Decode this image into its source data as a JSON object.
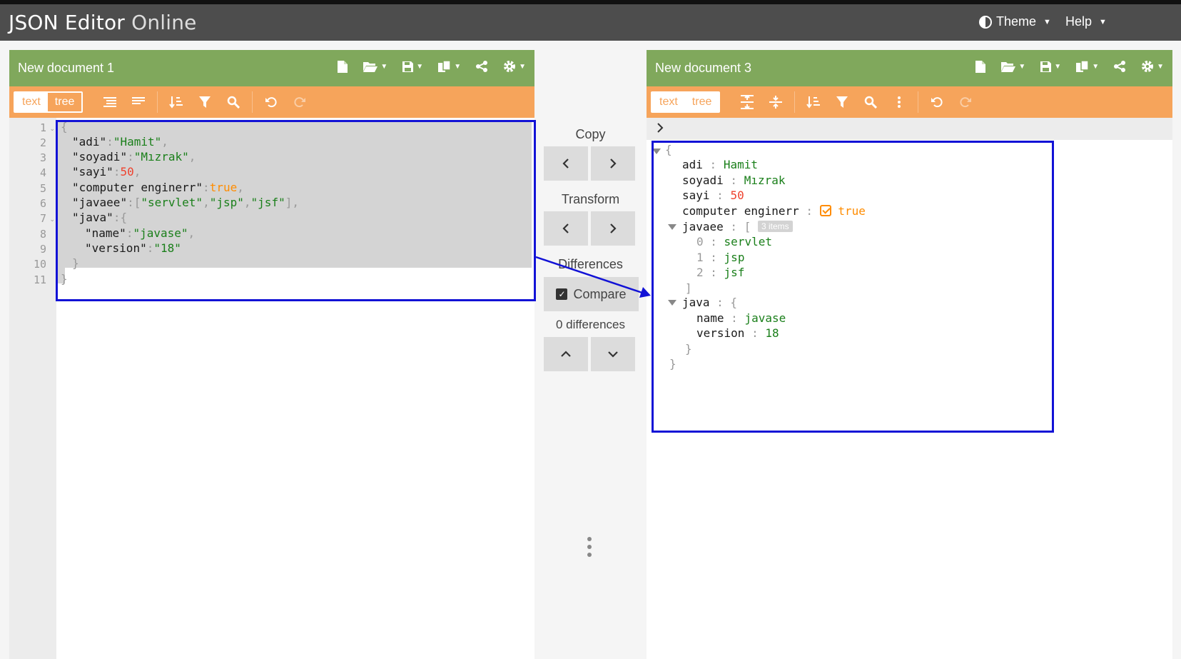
{
  "app": {
    "brand_bold": "JSON Editor",
    "brand_light": "Online",
    "theme_label": "Theme",
    "help_label": "Help"
  },
  "left": {
    "title": "New document 1",
    "mode_text": "text",
    "mode_tree": "tree",
    "line_numbers": [
      "1",
      "2",
      "3",
      "4",
      "5",
      "6",
      "7",
      "8",
      "9",
      "10",
      "11"
    ]
  },
  "right": {
    "title": "New document 3",
    "mode_text": "text",
    "mode_tree": "tree",
    "tree": {
      "open_brace": "{",
      "close_brace": "}",
      "adi_key": "adi",
      "adi_val": "Hamit",
      "soyadi_key": "soyadi",
      "soyadi_val": "Mızrak",
      "sayi_key": "sayi",
      "sayi_val": "50",
      "ce_key": "computer enginerr",
      "ce_val": "true",
      "javaee_key": "javaee",
      "javaee_tag": "3 items",
      "item0_idx": "0",
      "item0_val": "servlet",
      "item1_idx": "1",
      "item1_val": "jsp",
      "item2_idx": "2",
      "item2_val": "jsf",
      "java_key": "java",
      "name_key": "name",
      "name_val": "javase",
      "version_key": "version",
      "version_val": "18"
    }
  },
  "middle": {
    "copy_label": "Copy",
    "transform_label": "Transform",
    "differences_label": "Differences",
    "compare_label": "Compare",
    "diff_count": "0 differences"
  },
  "colors": {
    "title_bar": "#80a85c",
    "toolbar": "#f6a45b",
    "topbar": "#4d4d4d",
    "highlight_box": "#1212d6"
  }
}
